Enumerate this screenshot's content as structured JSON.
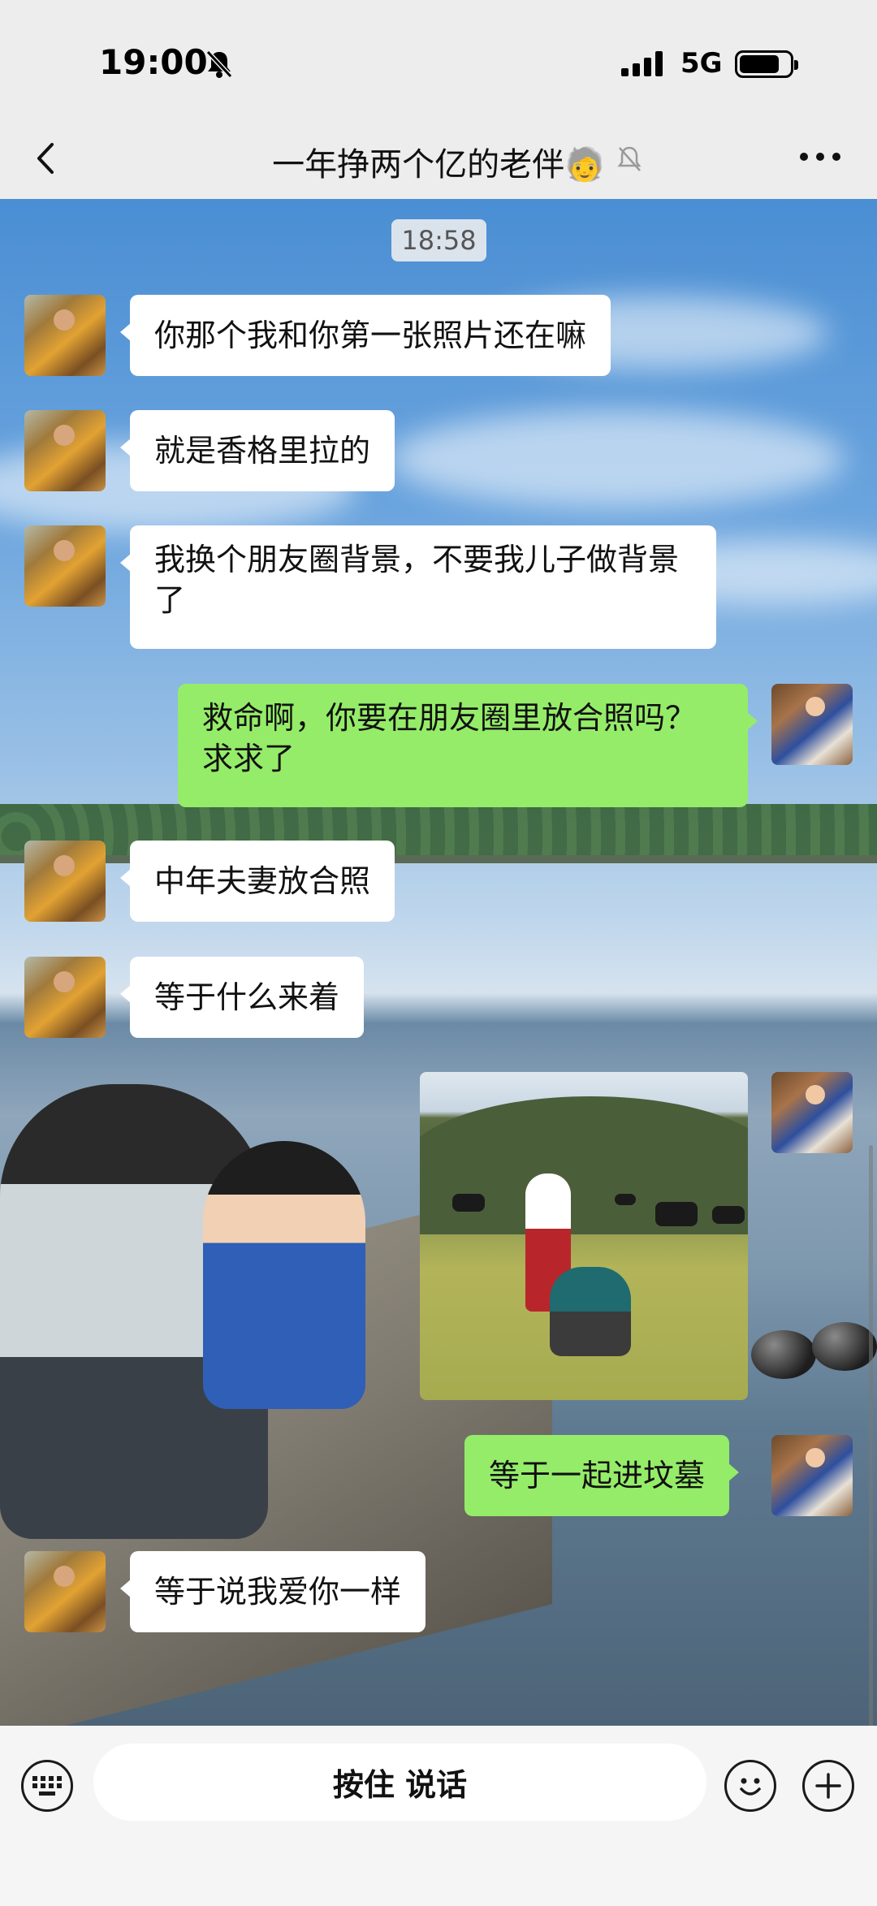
{
  "status_bar": {
    "time": "19:00",
    "network": "5G",
    "mute_icon": "bell-slash-icon",
    "battery_fraction": 0.8
  },
  "header": {
    "title": "一年挣两个亿的老伴🧓",
    "back_icon": "chevron-left-icon",
    "mute_icon": "bell-slash-icon",
    "more_icon": "ellipsis-icon"
  },
  "messages": {
    "timestamp": "18:58",
    "m1": "你那个我和你第一张照片还在嘛",
    "m2": "就是香格里拉的",
    "m3": "我换个朋友圈背景，不要我儿子做背景了",
    "m4": "救命啊，你要在朋友圈里放合照吗？求求了",
    "m5": "中年夫妻放合照",
    "m6": "等于什么来着",
    "m8": "等于一起进坟墓",
    "m9": "等于说我爱你一样"
  },
  "input_bar": {
    "voice_label": "按住 说话",
    "keyboard_icon": "keyboard-icon",
    "emoji_icon": "smiley-icon",
    "plus_icon": "plus-icon"
  },
  "colors": {
    "bubble_in": "#ffffff",
    "bubble_out": "#95ec69",
    "bar_bg": "#ededed"
  }
}
